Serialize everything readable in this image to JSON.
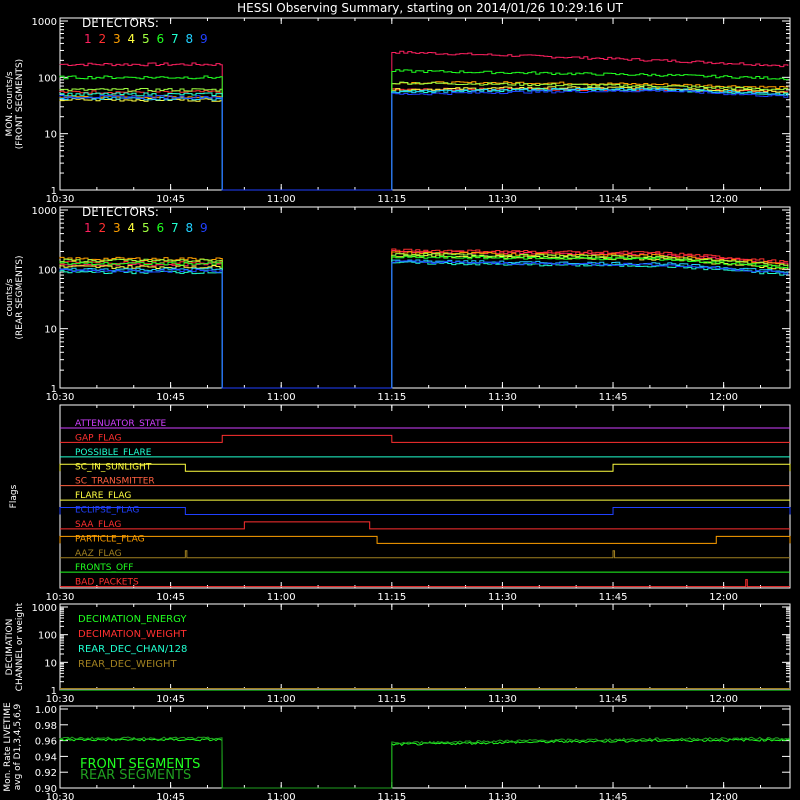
{
  "title": "HESSI Observing Summary, starting on 2014/01/26 10:29:16 UT",
  "colors": {
    "det": [
      "#ff2060",
      "#ff3030",
      "#ffa000",
      "#ffff40",
      "#a0ff40",
      "#20ff20",
      "#20ffd0",
      "#20d0ff",
      "#2040ff"
    ],
    "axis": "#ffffff"
  },
  "time_ticks": [
    "10:30",
    "10:45",
    "11:00",
    "11:15",
    "11:30",
    "11:45",
    "12:00"
  ],
  "chart_data": [
    {
      "type": "line",
      "panel": "front",
      "ylabel": [
        "MON. counts/s",
        "(FRONT SEGMENTS)"
      ],
      "yscale": "log",
      "ylim": [
        1,
        1000
      ],
      "yticks": [
        "1",
        "10",
        "100",
        "1000"
      ],
      "legend_title": "DETECTORS:",
      "legend_numbers": [
        "1",
        "2",
        "3",
        "4",
        "5",
        "6",
        "7",
        "8",
        "9"
      ],
      "xlim": [
        "10:30",
        "12:09"
      ],
      "gap": [
        "10:52",
        "11:15"
      ],
      "series": [
        {
          "name": "1",
          "values_before_gap": 170,
          "values_after_gap": [
            280,
            240,
            200,
            160
          ]
        },
        {
          "name": "2",
          "values_before_gap": 55,
          "values_after_gap": [
            60,
            62,
            60,
            55
          ]
        },
        {
          "name": "3",
          "values_before_gap": 45,
          "values_after_gap": [
            80,
            80,
            75,
            65
          ]
        },
        {
          "name": "4",
          "values_before_gap": 40,
          "values_after_gap": [
            60,
            65,
            65,
            55
          ]
        },
        {
          "name": "5",
          "values_before_gap": 60,
          "values_after_gap": [
            80,
            75,
            70,
            60
          ]
        },
        {
          "name": "6",
          "values_before_gap": 100,
          "values_after_gap": [
            130,
            120,
            110,
            95
          ]
        },
        {
          "name": "7",
          "values_before_gap": 50,
          "values_after_gap": [
            55,
            60,
            60,
            50
          ]
        },
        {
          "name": "8",
          "values_before_gap": 42,
          "values_after_gap": [
            55,
            60,
            62,
            50
          ]
        },
        {
          "name": "9",
          "values_before_gap": 45,
          "values_after_gap": [
            50,
            55,
            58,
            45
          ]
        }
      ]
    },
    {
      "type": "line",
      "panel": "rear",
      "ylabel": [
        "counts/s",
        "(REAR SEGMENTS)"
      ],
      "yscale": "log",
      "ylim": [
        1,
        1000
      ],
      "yticks": [
        "1",
        "10",
        "100",
        "1000"
      ],
      "legend_title": "DETECTORS:",
      "legend_numbers": [
        "1",
        "2",
        "3",
        "4",
        "5",
        "6",
        "7",
        "8",
        "9"
      ],
      "xlim": [
        "10:30",
        "12:09"
      ],
      "gap": [
        "10:52",
        "11:15"
      ],
      "series": [
        {
          "name": "1",
          "values_before_gap": 120,
          "values_after_gap": [
            200,
            190,
            180,
            120
          ]
        },
        {
          "name": "2",
          "values_before_gap": 130,
          "values_after_gap": [
            210,
            200,
            190,
            130
          ]
        },
        {
          "name": "3",
          "values_before_gap": 150,
          "values_after_gap": [
            190,
            180,
            170,
            120
          ]
        },
        {
          "name": "4",
          "values_before_gap": 110,
          "values_after_gap": [
            170,
            160,
            150,
            100
          ]
        },
        {
          "name": "5",
          "values_before_gap": 140,
          "values_after_gap": [
            180,
            170,
            160,
            115
          ]
        },
        {
          "name": "6",
          "values_before_gap": 125,
          "values_after_gap": [
            160,
            155,
            150,
            105
          ]
        },
        {
          "name": "7",
          "values_before_gap": 90,
          "values_after_gap": [
            130,
            120,
            115,
            80
          ]
        },
        {
          "name": "8",
          "values_before_gap": 100,
          "values_after_gap": [
            140,
            130,
            125,
            90
          ]
        },
        {
          "name": "9",
          "values_before_gap": 95,
          "values_after_gap": [
            135,
            125,
            120,
            85
          ]
        }
      ]
    },
    {
      "type": "line",
      "panel": "flags",
      "ylabel": [
        "Flags"
      ],
      "xlim": [
        "10:30",
        "12:09"
      ],
      "flags": [
        {
          "name": "ATTENUATOR_STATE",
          "color": "#d040ff",
          "on": []
        },
        {
          "name": "GAP_FLAG",
          "color": "#ff3030",
          "on": [
            [
              "10:52",
              "11:15"
            ]
          ]
        },
        {
          "name": "POSSIBLE_FLARE",
          "color": "#20ffd0",
          "on": []
        },
        {
          "name": "SC_IN_SUNLIGHT",
          "color": "#ffff40",
          "on": [
            [
              "10:30",
              "10:47"
            ],
            [
              "11:45",
              "12:09"
            ]
          ],
          "inverted": true
        },
        {
          "name": "SC_TRANSMITTER",
          "color": "#ff6040",
          "on": []
        },
        {
          "name": "FLARE_FLAG",
          "color": "#ffff40",
          "on": []
        },
        {
          "name": "ECLIPSE_FLAG",
          "color": "#2040ff",
          "on": [
            [
              "10:30",
              "10:47"
            ],
            [
              "11:45",
              "12:09"
            ]
          ]
        },
        {
          "name": "SAA_FLAG",
          "color": "#ff3030",
          "on": [
            [
              "10:55",
              "11:12"
            ]
          ]
        },
        {
          "name": "PARTICLE_FLAG",
          "color": "#ffa000",
          "on": [
            [
              "10:30",
              "11:13"
            ],
            [
              "11:59",
              "12:09"
            ]
          ]
        },
        {
          "name": "AAZ_FLAG",
          "color": "#a08020",
          "on": [
            [
              "10:47",
              "10:47"
            ],
            [
              "11:45",
              "11:45"
            ]
          ]
        },
        {
          "name": "FRONTS_OFF",
          "color": "#20ff20",
          "on": []
        },
        {
          "name": "BAD_PACKETS",
          "color": "#ff3030",
          "on": [
            [
              "12:03",
              "12:03"
            ]
          ]
        }
      ]
    },
    {
      "type": "line",
      "panel": "decimation",
      "ylabel": [
        "DECIMATION",
        "CHANNEL or weight"
      ],
      "yscale": "log",
      "ylim": [
        1,
        1000
      ],
      "yticks": [
        "1",
        "10",
        "100",
        "1000"
      ],
      "xlim": [
        "10:30",
        "12:09"
      ],
      "series": [
        {
          "name": "DECIMATION_ENERGY",
          "color": "#20ff20",
          "values": [
            1
          ]
        },
        {
          "name": "DECIMATION_WEIGHT",
          "color": "#ff3030",
          "values": [
            1
          ]
        },
        {
          "name": "REAR_DEC_CHAN/128",
          "color": "#20ffd0",
          "values": [
            1
          ]
        },
        {
          "name": "REAR_DEC_WEIGHT",
          "color": "#a08020",
          "values": [
            1
          ]
        }
      ]
    },
    {
      "type": "line",
      "panel": "livetime",
      "ylabel": [
        "Mon. Rate LIVETIME",
        "avg of D1,3,4,5,6,9"
      ],
      "ylim": [
        0.9,
        1.0
      ],
      "yticks": [
        "0.90",
        "0.92",
        "0.94",
        "0.96",
        "0.98",
        "1.00"
      ],
      "xlim": [
        "10:30",
        "12:09"
      ],
      "gap": [
        "10:52",
        "11:15"
      ],
      "series": [
        {
          "name": "FRONT SEGMENTS",
          "color": "#20ff20",
          "values_before_gap": 0.961,
          "values_after_gap": [
            0.955,
            0.958,
            0.96,
            0.961
          ]
        },
        {
          "name": "REAR SEGMENTS",
          "color": "#20a020",
          "values_before_gap": 0.963,
          "values_after_gap": [
            0.957,
            0.96,
            0.962,
            0.963
          ]
        }
      ]
    }
  ]
}
